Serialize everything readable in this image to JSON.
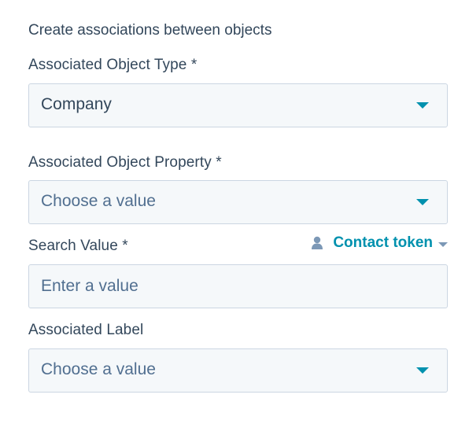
{
  "description": "Create associations between objects",
  "fields": {
    "object_type": {
      "label": "Associated Object Type *",
      "value": "Company"
    },
    "object_property": {
      "label": "Associated Object Property *",
      "placeholder": "Choose a value"
    },
    "search_value": {
      "label": "Search Value *",
      "placeholder": "Enter a value",
      "token_link": "Contact token"
    },
    "associated_label": {
      "label": "Associated Label",
      "placeholder": "Choose a value"
    }
  },
  "colors": {
    "text": "#33475b",
    "placeholder": "#516f90",
    "accent": "#0091ae",
    "field_bg": "#f5f8fa",
    "field_border": "#cbd6e2",
    "icon_grey": "#7c98b6"
  },
  "icons": {
    "dropdown": "caret-down-icon",
    "token": "person-icon"
  }
}
